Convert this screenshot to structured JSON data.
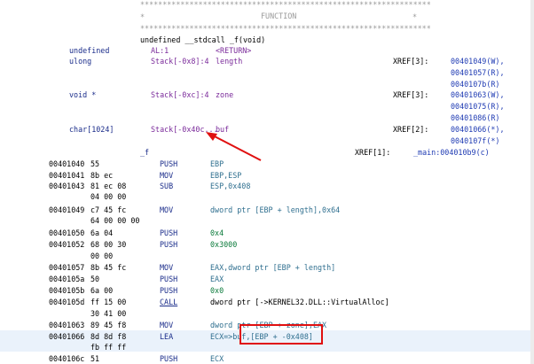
{
  "banner": {
    "stars": "*****************************************************************",
    "edge_star": "*",
    "label": "FUNCTION"
  },
  "signature": "undefined __stdcall _f(void)",
  "vars": [
    {
      "type": "undefined",
      "storage": "AL:1",
      "name": "<RETURN>"
    },
    {
      "type": "ulong",
      "storage": "Stack[-0x8]:4",
      "name": "length",
      "xref_label": "XREF[3]:",
      "xrefs": [
        "00401049(W),",
        "00401057(R),",
        "0040107b(R)"
      ]
    },
    {
      "type": "void *",
      "storage": "Stack[-0xc]:4",
      "name": "zone",
      "xref_label": "XREF[3]:",
      "xrefs": [
        "00401063(W),",
        "00401075(R),",
        "00401086(R)"
      ]
    },
    {
      "type": "char[1024]",
      "storage": "Stack[-0x40c...",
      "name": "buf",
      "xref_label": "XREF[2]:",
      "xrefs": [
        "00401066(*),",
        "0040107f(*)"
      ]
    }
  ],
  "function_label": {
    "name": "_f",
    "xref_label": "XREF[1]:",
    "xref": "_main:004010b9(c)"
  },
  "instructions": [
    {
      "addr": "00401040",
      "bytes": "55",
      "mnemonic": "PUSH",
      "operands": "EBP"
    },
    {
      "addr": "00401041",
      "bytes": "8b ec",
      "mnemonic": "MOV",
      "operands": "EBP,ESP"
    },
    {
      "addr": "00401043",
      "bytes": "81 ec 08",
      "bytes2": "04 00 00",
      "mnemonic": "SUB",
      "operands": "ESP,0x408"
    },
    {
      "addr": "00401049",
      "bytes": "c7 45 fc",
      "bytes2": "64 00 00 00",
      "mnemonic": "MOV",
      "operands": "dword ptr [EBP + length],0x64"
    },
    {
      "addr": "00401050",
      "bytes": "6a 04",
      "mnemonic": "PUSH",
      "operands": "0x4"
    },
    {
      "addr": "00401052",
      "bytes": "68 00 30",
      "bytes2": "00 00",
      "mnemonic": "PUSH",
      "operands": "0x3000"
    },
    {
      "addr": "00401057",
      "bytes": "8b 45 fc",
      "mnemonic": "MOV",
      "operands": "EAX,dword ptr [EBP + length]"
    },
    {
      "addr": "0040105a",
      "bytes": "50",
      "mnemonic": "PUSH",
      "operands": "EAX"
    },
    {
      "addr": "0040105b",
      "bytes": "6a 00",
      "mnemonic": "PUSH",
      "operands": "0x0"
    },
    {
      "addr": "0040105d",
      "bytes": "ff 15 00",
      "bytes2": "30 41 00",
      "mnemonic": "CALL",
      "operands": "dword ptr [->KERNEL32.DLL::VirtualAlloc]"
    },
    {
      "addr": "00401063",
      "bytes": "89 45 f8",
      "mnemonic": "MOV",
      "operands": "dword ptr [EBP + zone],EAX"
    },
    {
      "addr": "00401066",
      "bytes": "8d 8d f8",
      "bytes2": "fb ff ff",
      "mnemonic": "LEA",
      "operands": "ECX=>buf,[EBP + -0x408]"
    },
    {
      "addr": "0040106c",
      "bytes": "51",
      "mnemonic": "PUSH",
      "operands": "ECX"
    }
  ],
  "colors": {
    "annotation": "#e01010",
    "highlight_row": "#eaf2fb"
  }
}
